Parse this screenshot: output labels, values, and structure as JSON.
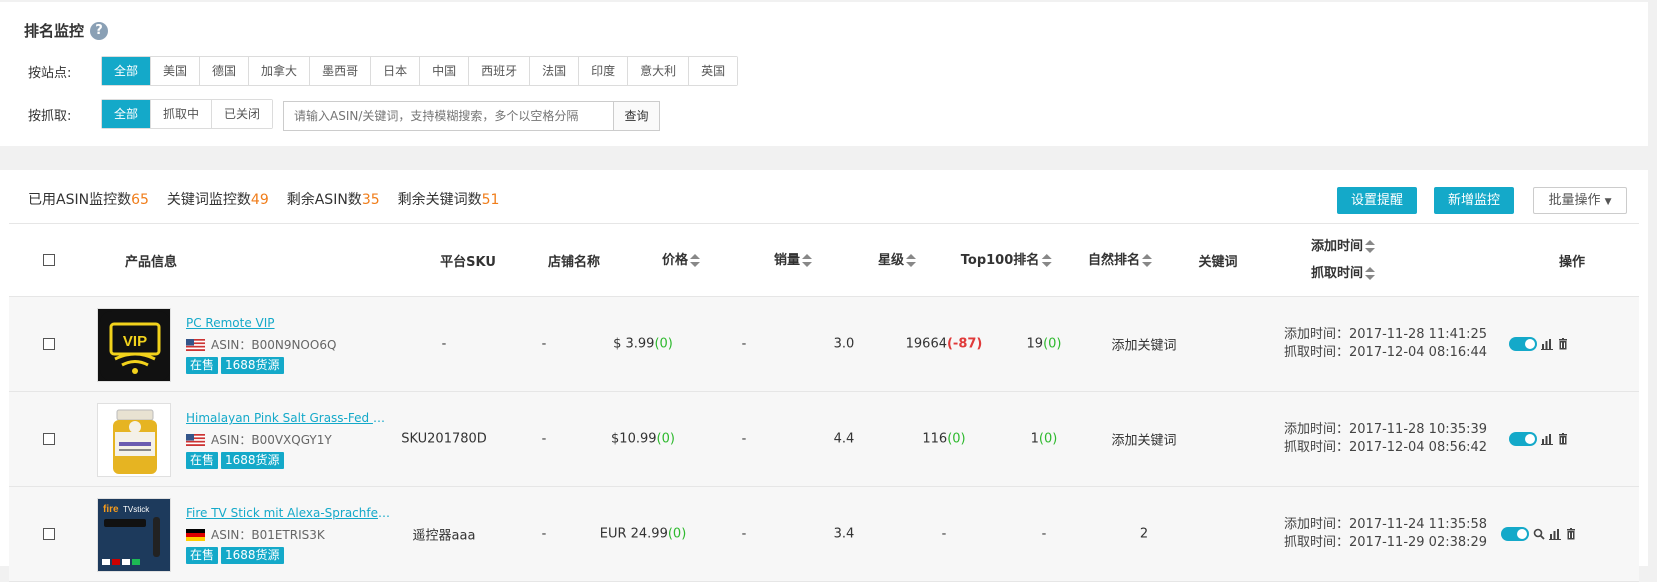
{
  "panel": {
    "title": "排名监控",
    "help_icon": "?"
  },
  "filters": {
    "site_label": "按站点:",
    "sites": [
      "全部",
      "美国",
      "德国",
      "加拿大",
      "墨西哥",
      "日本",
      "中国",
      "西班牙",
      "法国",
      "印度",
      "意大利",
      "英国"
    ],
    "crawl_label": "按抓取:",
    "crawl": [
      "全部",
      "抓取中",
      "已关闭"
    ],
    "search_placeholder": "请输入ASIN/关键词，支持模糊搜索，多个以空格分隔",
    "search_button": "查询"
  },
  "stats": {
    "asin_used_label": "已用ASIN监控数",
    "asin_used": "65",
    "kw_label": "关键词监控数",
    "kw": "49",
    "asin_left_label": "剩余ASIN数",
    "asin_left": "35",
    "kw_left_label": "剩余关键词数",
    "kw_left": "51"
  },
  "actions": {
    "set_alert": "设置提醒",
    "add_monitor": "新增监控",
    "batch": "批量操作"
  },
  "columns": {
    "product": "产品信息",
    "sku": "平台SKU",
    "store": "店铺名称",
    "price": "价格",
    "sales": "销量",
    "stars": "星级",
    "top100": "Top100排名",
    "natural": "自然排名",
    "keyword": "关键词",
    "added": "添加时间",
    "fetched": "抓取时间",
    "ops": "操作"
  },
  "rows": [
    {
      "name": "PC Remote VIP",
      "asin_label": "ASIN：",
      "asin": "B00N9NOO6Q",
      "flag": "us-flag",
      "tags": [
        "在售",
        "1688货源"
      ],
      "sku": "-",
      "store": "-",
      "price": "$ 3.99",
      "price_delta": "(0)",
      "sales": "-",
      "stars": "3.0",
      "top100": "19664",
      "top100_delta": "(-87)",
      "natural": "19",
      "natural_delta": "(0)",
      "keyword": "添加关键词",
      "added": "添加时间：2017-11-28 11:41:25",
      "fetched": "抓取时间：2017-12-04 08:16:44"
    },
    {
      "name": "Himalayan Pink Salt Grass-Fed Ghee...",
      "asin_label": "ASIN：",
      "asin": "B00VXQGY1Y",
      "flag": "us-flag",
      "tags": [
        "在售",
        "1688货源"
      ],
      "sku": "SKU201780D",
      "store": "-",
      "price": "$10.99",
      "price_delta": "(0)",
      "sales": "-",
      "stars": "4.4",
      "top100": "116",
      "top100_delta": "(0)",
      "natural": "1",
      "natural_delta": "(0)",
      "keyword": "添加关键词",
      "added": "添加时间：2017-11-28 10:35:39",
      "fetched": "抓取时间：2017-12-04 08:56:42"
    },
    {
      "name": "Fire TV Stick mit Alexa-Sprachfernbe...",
      "asin_label": "ASIN：",
      "asin": "B01ETRIS3K",
      "flag": "de-flag",
      "tags": [
        "在售",
        "1688货源"
      ],
      "sku": "遥控器aaa",
      "store": "-",
      "price": "EUR 24.99",
      "price_delta": "(0)",
      "sales": "-",
      "stars": "3.4",
      "top100": "-",
      "top100_delta": "",
      "natural": "-",
      "natural_delta": "",
      "keyword": "2",
      "added": "添加时间：2017-11-24 11:35:58",
      "fetched": "抓取时间：2017-11-29 02:38:29"
    }
  ]
}
